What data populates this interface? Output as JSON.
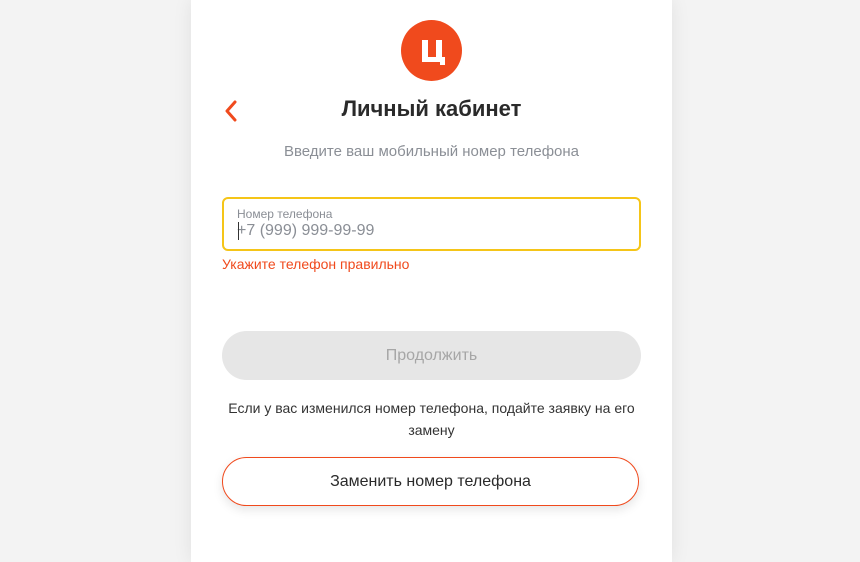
{
  "logo": {
    "letter": "Ц",
    "color": "#f04a1d"
  },
  "header": {
    "back_icon": "chevron-left-icon",
    "title": "Личный кабинет",
    "subtitle": "Введите ваш мобильный номер телефона"
  },
  "phone_field": {
    "label": "Номер телефона",
    "placeholder": "+7 (999) 999-99-99",
    "value": "",
    "border_color": "#f5c518"
  },
  "error": {
    "text": "Укажите телефон правильно",
    "color": "#f04a1d"
  },
  "buttons": {
    "continue_label": "Продолжить",
    "continue_disabled": true,
    "replace_label": "Заменить номер телефона"
  },
  "note": {
    "text": "Если у вас изменился номер телефона, подайте заявку на его замену"
  }
}
